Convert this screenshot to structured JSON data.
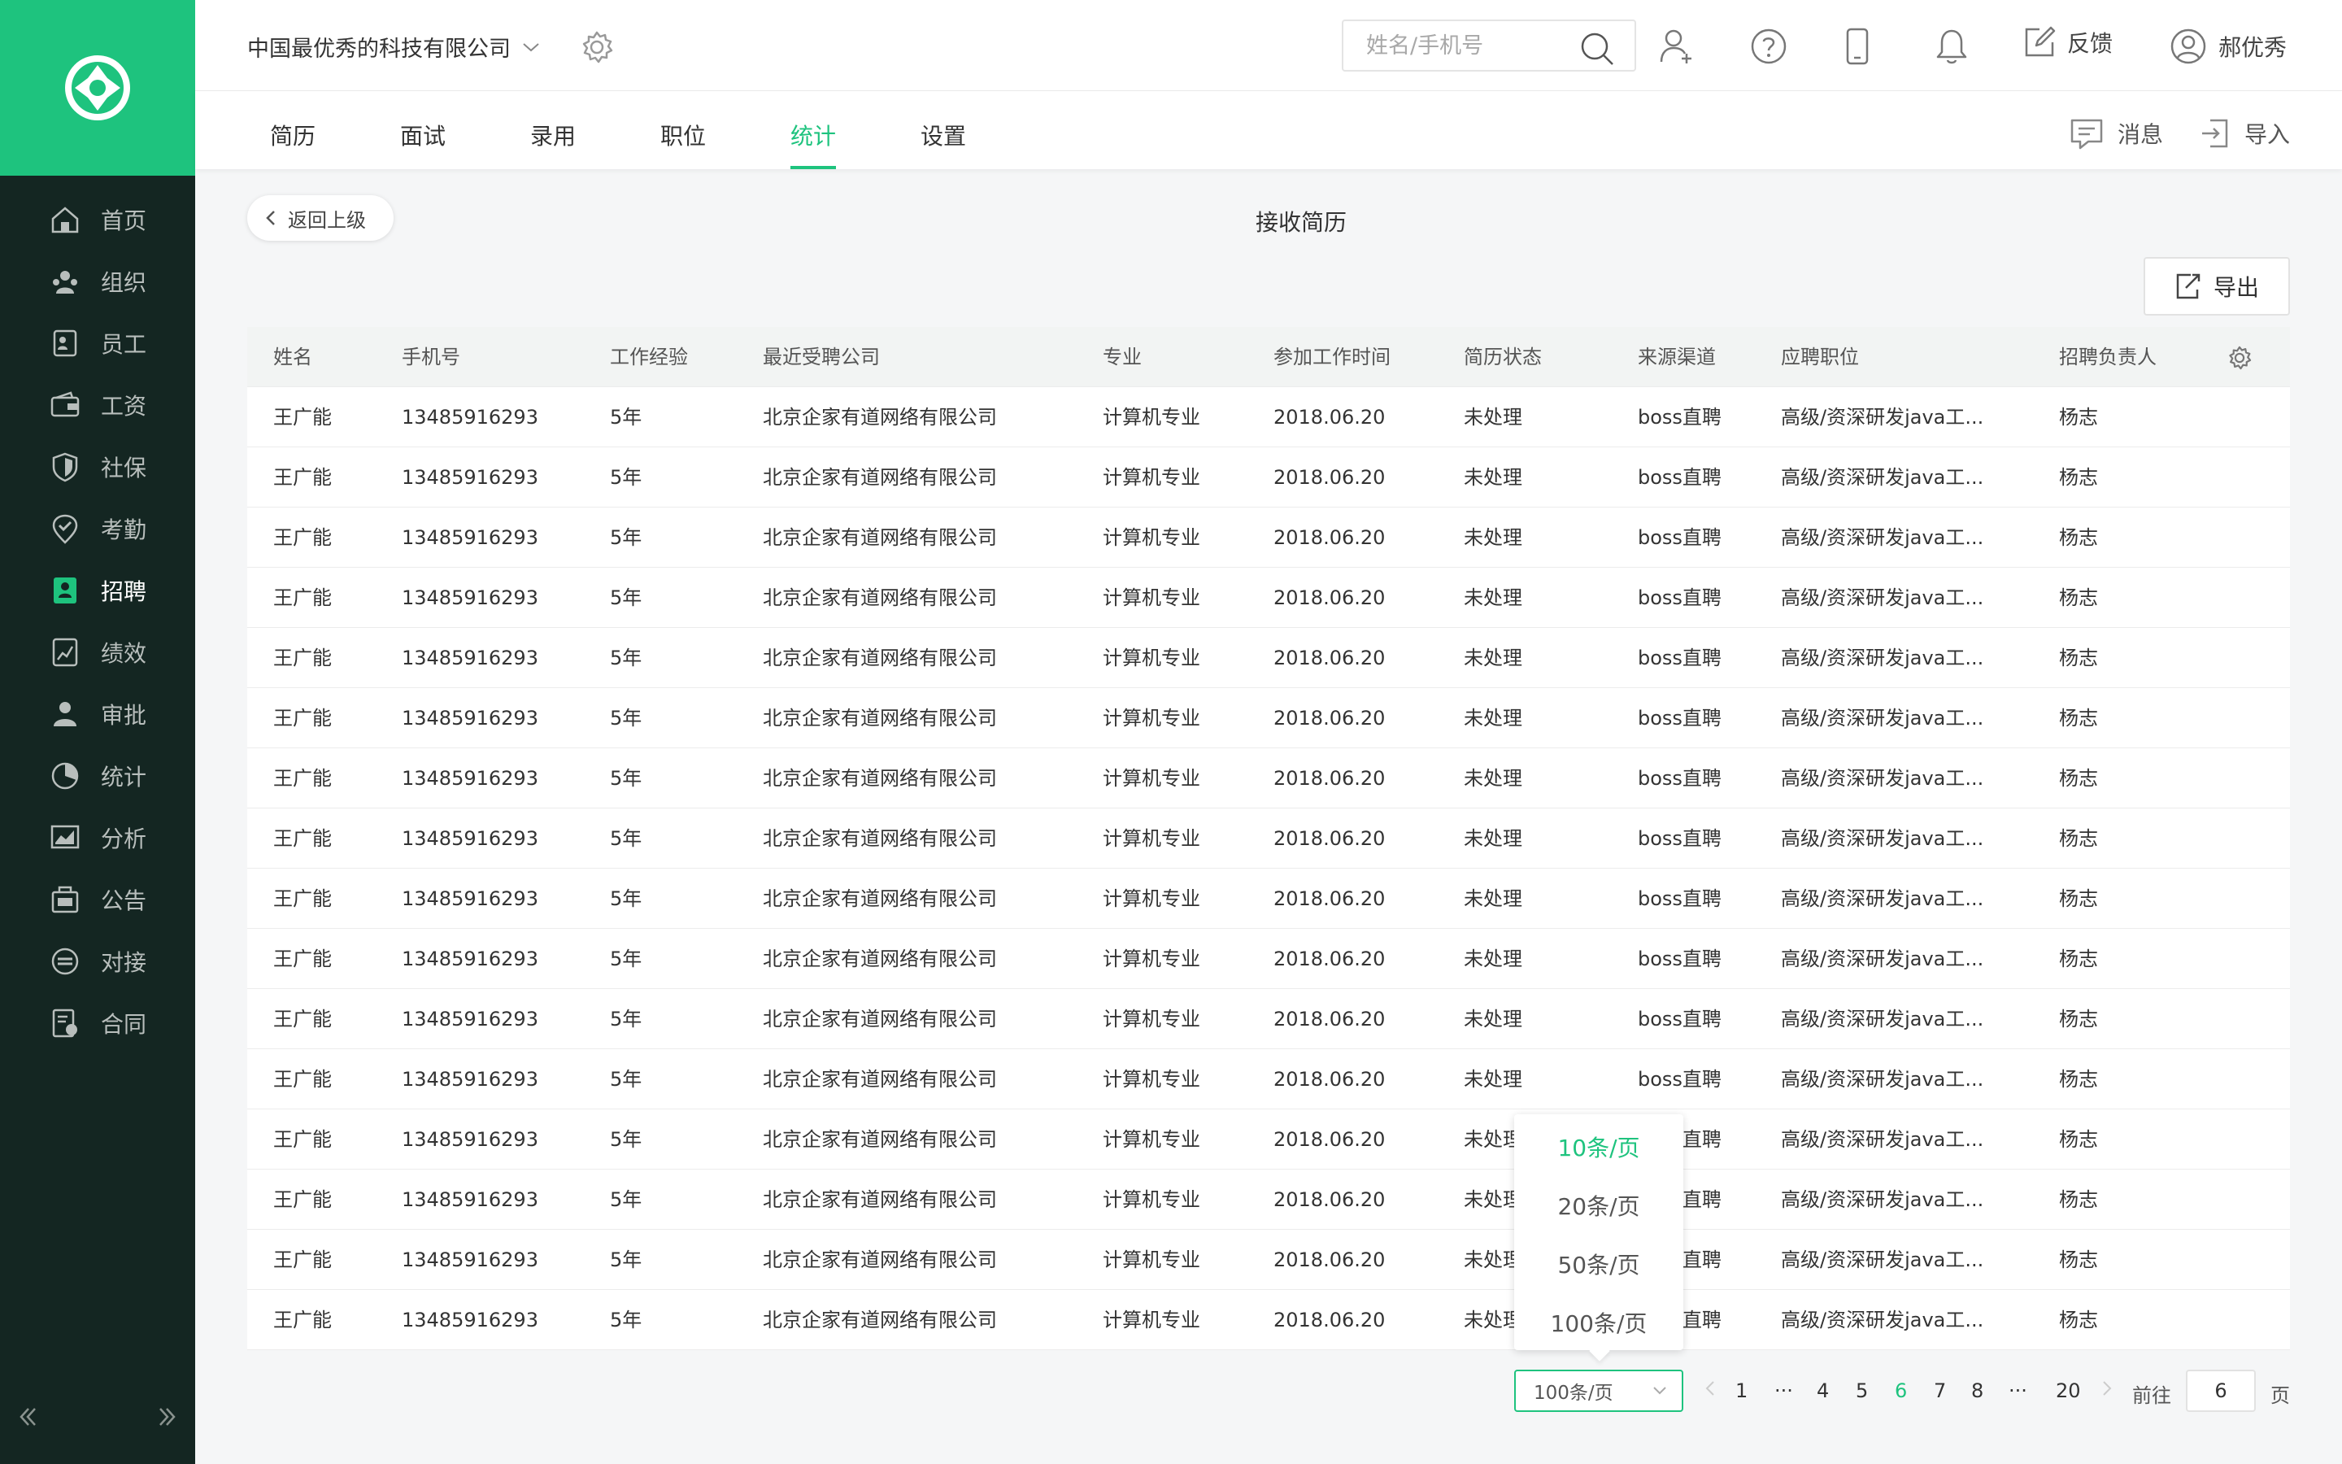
{
  "sidebar": {
    "items": [
      {
        "label": "首页",
        "icon": "home-icon"
      },
      {
        "label": "组织",
        "icon": "organization-icon"
      },
      {
        "label": "员工",
        "icon": "employee-icon"
      },
      {
        "label": "工资",
        "icon": "wallet-icon"
      },
      {
        "label": "社保",
        "icon": "shield-icon"
      },
      {
        "label": "考勤",
        "icon": "location-check-icon"
      },
      {
        "label": "招聘",
        "icon": "recruit-icon"
      },
      {
        "label": "绩效",
        "icon": "performance-icon"
      },
      {
        "label": "审批",
        "icon": "approval-icon"
      },
      {
        "label": "统计",
        "icon": "pie-chart-icon"
      },
      {
        "label": "分析",
        "icon": "analysis-icon"
      },
      {
        "label": "公告",
        "icon": "announcement-icon"
      },
      {
        "label": "对接",
        "icon": "connect-icon"
      },
      {
        "label": "合同",
        "icon": "contract-icon"
      }
    ],
    "active_index": 6
  },
  "header": {
    "company": "中国最优秀的科技有限公司",
    "search_placeholder": "姓名/手机号",
    "feedback": "反馈",
    "user": "郝优秀"
  },
  "tabs": {
    "items": [
      "简历",
      "面试",
      "录用",
      "职位",
      "统计",
      "设置"
    ],
    "active_index": 4,
    "message": "消息",
    "import": "导入"
  },
  "content": {
    "back": "返回上级",
    "title": "接收简历",
    "export": "导出"
  },
  "table": {
    "headers": [
      "姓名",
      "手机号",
      "工作经验",
      "最近受聘公司",
      "专业",
      "参加工作时间",
      "简历状态",
      "来源渠道",
      "应聘职位",
      "招聘负责人"
    ],
    "rows": [
      [
        "王广能",
        "13485916293",
        "5年",
        "北京企家有道网络有限公司",
        "计算机专业",
        "2018.06.20",
        "未处理",
        "boss直聘",
        "高级/资深研发java工...",
        "杨志"
      ],
      [
        "王广能",
        "13485916293",
        "5年",
        "北京企家有道网络有限公司",
        "计算机专业",
        "2018.06.20",
        "未处理",
        "boss直聘",
        "高级/资深研发java工...",
        "杨志"
      ],
      [
        "王广能",
        "13485916293",
        "5年",
        "北京企家有道网络有限公司",
        "计算机专业",
        "2018.06.20",
        "未处理",
        "boss直聘",
        "高级/资深研发java工...",
        "杨志"
      ],
      [
        "王广能",
        "13485916293",
        "5年",
        "北京企家有道网络有限公司",
        "计算机专业",
        "2018.06.20",
        "未处理",
        "boss直聘",
        "高级/资深研发java工...",
        "杨志"
      ],
      [
        "王广能",
        "13485916293",
        "5年",
        "北京企家有道网络有限公司",
        "计算机专业",
        "2018.06.20",
        "未处理",
        "boss直聘",
        "高级/资深研发java工...",
        "杨志"
      ],
      [
        "王广能",
        "13485916293",
        "5年",
        "北京企家有道网络有限公司",
        "计算机专业",
        "2018.06.20",
        "未处理",
        "boss直聘",
        "高级/资深研发java工...",
        "杨志"
      ],
      [
        "王广能",
        "13485916293",
        "5年",
        "北京企家有道网络有限公司",
        "计算机专业",
        "2018.06.20",
        "未处理",
        "boss直聘",
        "高级/资深研发java工...",
        "杨志"
      ],
      [
        "王广能",
        "13485916293",
        "5年",
        "北京企家有道网络有限公司",
        "计算机专业",
        "2018.06.20",
        "未处理",
        "boss直聘",
        "高级/资深研发java工...",
        "杨志"
      ],
      [
        "王广能",
        "13485916293",
        "5年",
        "北京企家有道网络有限公司",
        "计算机专业",
        "2018.06.20",
        "未处理",
        "boss直聘",
        "高级/资深研发java工...",
        "杨志"
      ],
      [
        "王广能",
        "13485916293",
        "5年",
        "北京企家有道网络有限公司",
        "计算机专业",
        "2018.06.20",
        "未处理",
        "boss直聘",
        "高级/资深研发java工...",
        "杨志"
      ],
      [
        "王广能",
        "13485916293",
        "5年",
        "北京企家有道网络有限公司",
        "计算机专业",
        "2018.06.20",
        "未处理",
        "boss直聘",
        "高级/资深研发java工...",
        "杨志"
      ],
      [
        "王广能",
        "13485916293",
        "5年",
        "北京企家有道网络有限公司",
        "计算机专业",
        "2018.06.20",
        "未处理",
        "boss直聘",
        "高级/资深研发java工...",
        "杨志"
      ],
      [
        "王广能",
        "13485916293",
        "5年",
        "北京企家有道网络有限公司",
        "计算机专业",
        "2018.06.20",
        "未处理",
        "boss直聘",
        "高级/资深研发java工...",
        "杨志"
      ],
      [
        "王广能",
        "13485916293",
        "5年",
        "北京企家有道网络有限公司",
        "计算机专业",
        "2018.06.20",
        "未处理",
        "boss直聘",
        "高级/资深研发java工...",
        "杨志"
      ],
      [
        "王广能",
        "13485916293",
        "5年",
        "北京企家有道网络有限公司",
        "计算机专业",
        "2018.06.20",
        "未处理",
        "boss直聘",
        "高级/资深研发java工...",
        "杨志"
      ],
      [
        "王广能",
        "13485916293",
        "5年",
        "北京企家有道网络有限公司",
        "计算机专业",
        "2018.06.20",
        "未处理",
        "boss直聘",
        "高级/资深研发java工...",
        "杨志"
      ]
    ]
  },
  "pagination": {
    "page_size": "100条/页",
    "size_options": [
      "10条/页",
      "20条/页",
      "50条/页",
      "100条/页"
    ],
    "selected_option_index": 0,
    "pages": [
      "1",
      "···",
      "4",
      "5",
      "6",
      "7",
      "8",
      "···",
      "20"
    ],
    "current_page": "6",
    "goto_label": "前往",
    "goto_value": "6",
    "page_unit": "页"
  },
  "colors": {
    "accent": "#1ec37e",
    "sidebar_bg": "#142622"
  }
}
